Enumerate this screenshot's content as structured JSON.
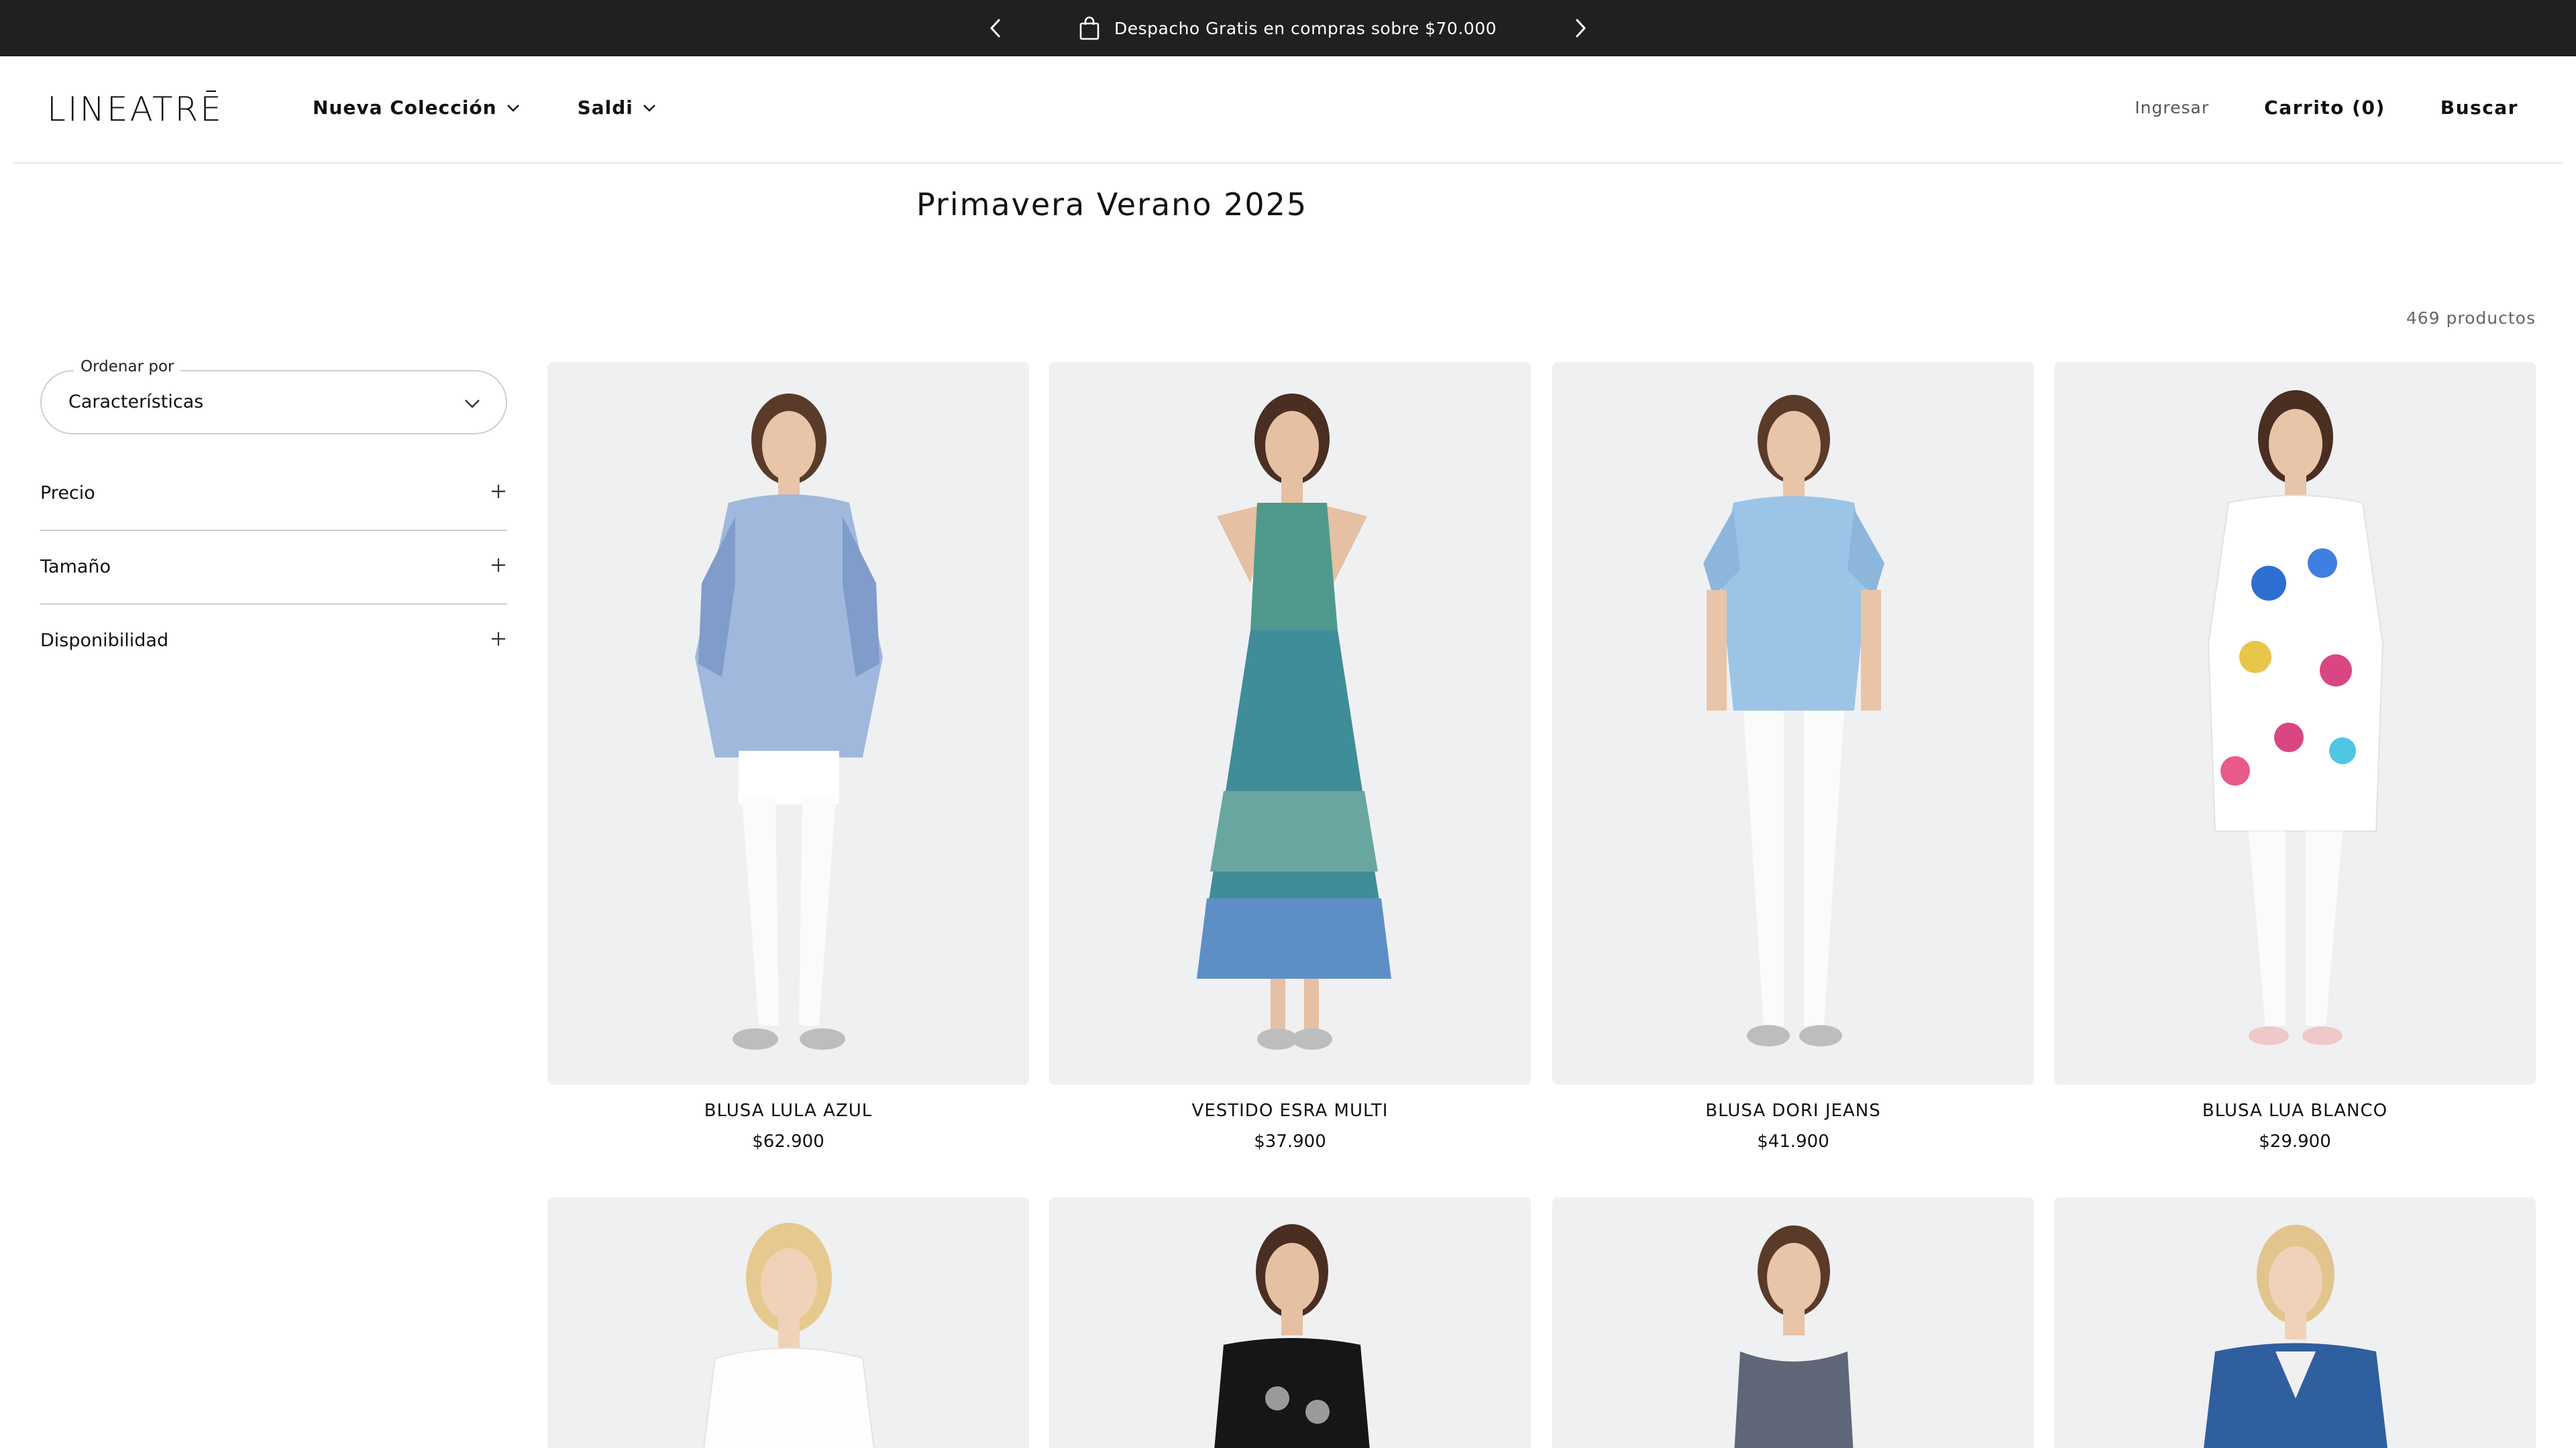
{
  "announcement": {
    "text": "Despacho Gratis en compras sobre $70.000"
  },
  "header": {
    "logo": "LINEATRĒ",
    "nav": [
      {
        "label": "Nueva Colección"
      },
      {
        "label": "Saldi"
      }
    ],
    "login": "Ingresar",
    "cart": "Carrito (0)",
    "search": "Buscar"
  },
  "collection": {
    "title": "Primavera Verano 2025",
    "count": "469 productos"
  },
  "sidebar": {
    "sort_label": "Ordenar por",
    "sort_value": "Características",
    "filters": [
      {
        "label": "Precio"
      },
      {
        "label": "Tamaño"
      },
      {
        "label": "Disponibilidad"
      }
    ]
  },
  "products": [
    {
      "name": "BLUSA LULA AZUL",
      "price": "$62.900"
    },
    {
      "name": "VESTIDO ESRA MULTI",
      "price": "$37.900"
    },
    {
      "name": "BLUSA DORI JEANS",
      "price": "$41.900"
    },
    {
      "name": "BLUSA LUA BLANCO",
      "price": "$29.900"
    }
  ],
  "colors": {
    "topbar": "#202020",
    "image_bg": "#eff0f2",
    "border": "#cfcfcf"
  }
}
